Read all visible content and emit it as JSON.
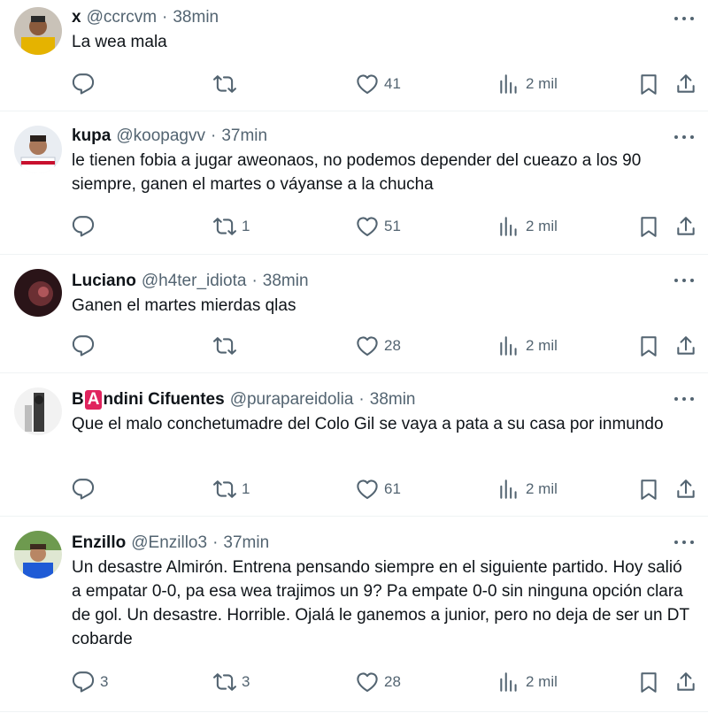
{
  "tweets": [
    {
      "name": "x",
      "handle": "@ccrcvm",
      "sep": "·",
      "time": "38min",
      "text": "La wea mala",
      "reply_count": "",
      "retweet_count": "",
      "like_count": "41",
      "views": "2 mil",
      "avatar_color": "#e5b300"
    },
    {
      "name": "kupa",
      "handle": "@koopagvv",
      "sep": "·",
      "time": "37min",
      "text": "le tienen fobia a jugar aweonaos, no podemos depender del cueazo a los 90 siempre, ganen el martes o váyanse a la chucha",
      "reply_count": "",
      "retweet_count": "1",
      "like_count": "51",
      "views": "2 mil",
      "avatar_color": "#cfd8e6"
    },
    {
      "name": "Luciano",
      "handle": "@h4ter_idiota",
      "sep": "·",
      "time": "38min",
      "text": "Ganen el martes mierdas qlas",
      "reply_count": "",
      "retweet_count": "",
      "like_count": "28",
      "views": "2 mil",
      "avatar_color": "#3a1e22"
    },
    {
      "name_pre": "B",
      "name_badge": "A",
      "name_post": "ndini Cifuentes",
      "handle": "@purapareidolia",
      "sep": "·",
      "time": "38min",
      "text": "Que el malo conchetumadre del Colo Gil se vaya a pata a su casa por inmundo",
      "reply_count": "",
      "retweet_count": "1",
      "like_count": "61",
      "views": "2 mil",
      "avatar_color": "#d9d9d9"
    },
    {
      "name": "Enzillo",
      "handle": "@Enzillo3",
      "sep": "·",
      "time": "37min",
      "text": "Un desastre Almirón. Entrena pensando siempre en el siguiente partido. Hoy salió a empatar 0-0, pa esa wea trajimos un 9? Pa empate 0-0 sin ninguna opción clara de gol. Un desastre. Horrible. Ojalá le ganemos a junior, pero no deja de ser un DT cobarde",
      "reply_count": "3",
      "retweet_count": "3",
      "like_count": "28",
      "views": "2 mil",
      "avatar_color": "#5d8a4a"
    }
  ],
  "colors": {
    "text": "#0f1419",
    "secondary": "#536471",
    "border": "#eff3f4",
    "badge": "#e0245e"
  },
  "icons": [
    "reply-icon",
    "retweet-icon",
    "like-icon",
    "views-icon",
    "bookmark-icon",
    "share-icon",
    "more-icon"
  ]
}
